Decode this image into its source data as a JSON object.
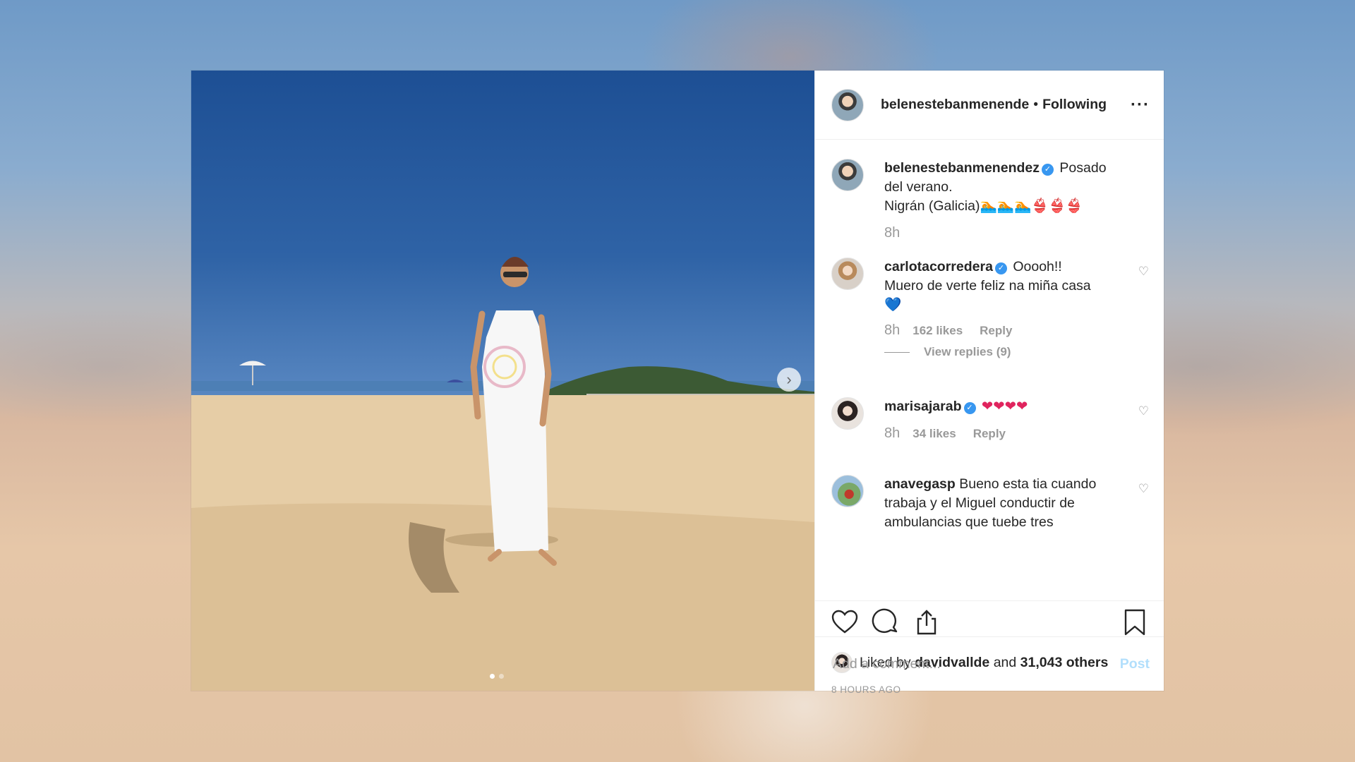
{
  "post": {
    "author": "belenestebanmenende",
    "separator": "•",
    "follow_status": "Following",
    "more": "···"
  },
  "caption": {
    "user": "belenestebanmenendez",
    "text": "Posado del verano.",
    "location_line": "Nigrán (Galicia)🏊🏊🏊👙👙👙",
    "time": "8h"
  },
  "comments": [
    {
      "user": "carlotacorredera",
      "verified": true,
      "text_line1": "Ooooh!!",
      "text_line2": "Muero de verte feliz na miña casa",
      "emoji": "💙",
      "time": "8h",
      "likes": "162 likes",
      "reply": "Reply",
      "view_replies": "View replies (9)"
    },
    {
      "user": "marisajarab",
      "verified": true,
      "emoji": "❤❤❤❤",
      "time": "8h",
      "likes": "34 likes",
      "reply": "Reply"
    },
    {
      "user": "anavegasp",
      "verified": false,
      "text": "Bueno esta tia cuando trabaja y el Miguel conductir de ambulancias que tuebe tres"
    }
  ],
  "likes": {
    "prefix": "Liked by",
    "user": "davidvallde",
    "and": "and",
    "others": "31,043 others"
  },
  "timestamp": "8 HOURS AGO",
  "add_comment": {
    "placeholder": "Add a comment...",
    "post_label": "Post"
  },
  "carousel": {
    "total": 2,
    "current": 1,
    "next_icon": "chevron-right-icon"
  },
  "colors": {
    "link_disabled": "#b2dffc",
    "verified": "#3897f0",
    "meta": "#999999"
  }
}
